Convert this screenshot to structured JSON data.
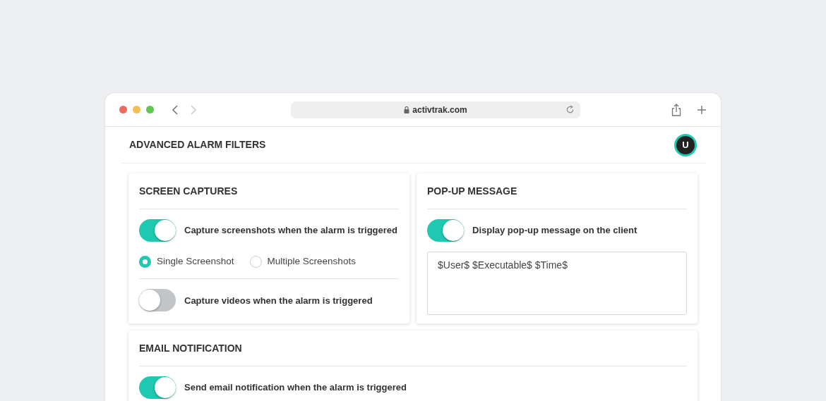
{
  "browser": {
    "url": "activtrak.com"
  },
  "page": {
    "title": "ADVANCED ALARM FILTERS",
    "avatar": "U"
  },
  "panels": [
    {
      "title": "SCREEN CAPTURES",
      "kind": "half",
      "rows": [
        {
          "kind": "toggle",
          "label": "Capture screenshots when the alarm is triggered",
          "on": true
        },
        {
          "kind": "radios",
          "options": [
            {
              "label": "Single Screenshot",
              "selected": true
            },
            {
              "label": "Multiple Screenshots",
              "selected": false
            }
          ]
        },
        {
          "kind": "toggle",
          "label": "Capture videos when the alarm is triggered",
          "on": false
        }
      ]
    },
    {
      "title": "POP-UP MESSAGE",
      "kind": "half",
      "rows": [
        {
          "kind": "toggle",
          "label": "Display pop-up message on the client",
          "on": true
        },
        {
          "kind": "textarea",
          "value": "$User$ $Executable$ $Time$"
        }
      ]
    },
    {
      "title": "EMAIL NOTIFICATION",
      "kind": "full",
      "rows": [
        {
          "kind": "toggle",
          "label": "Send email notification when the alarm is triggered",
          "on": true
        }
      ]
    }
  ]
}
